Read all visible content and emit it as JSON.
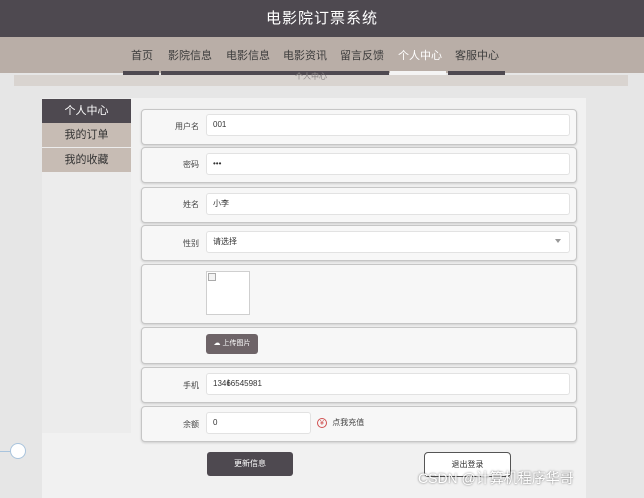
{
  "header": {
    "title": "电影院订票系统"
  },
  "nav": {
    "items": [
      "首页",
      "影院信息",
      "电影信息",
      "电影资讯",
      "留言反馈",
      "个人中心",
      "客服中心"
    ],
    "active": "个人中心"
  },
  "banner": {
    "text": "个人中心"
  },
  "sidebar": {
    "items": [
      "个人中心",
      "我的订单",
      "我的收藏"
    ]
  },
  "form": {
    "username": {
      "label": "用户名",
      "value": "001"
    },
    "password": {
      "label": "密码",
      "value": "•••"
    },
    "name": {
      "label": "姓名",
      "value": "小李"
    },
    "gender": {
      "label": "性别",
      "selected": "请选择"
    },
    "upload": {
      "label": "上传图片"
    },
    "phone": {
      "label": "手机",
      "value": "13466545981"
    },
    "balance": {
      "label": "余额",
      "value": "0",
      "recharge_label": "点我充值",
      "recharge_icon": "¥"
    }
  },
  "actions": {
    "update": "更新信息",
    "logout": "退出登录"
  },
  "watermark": "CSDN @计算机程序华哥",
  "colors": {
    "header": "#4e4950",
    "nav": "#b9aea7",
    "active_side": "#4e4950",
    "side_item": "#c7bcb4"
  }
}
